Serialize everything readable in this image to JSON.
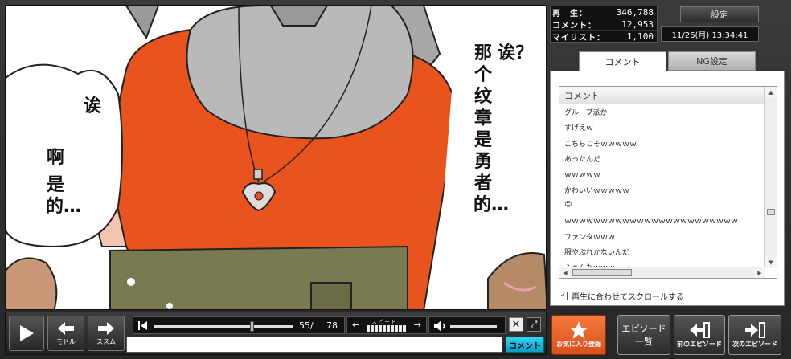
{
  "video": {
    "bubble_left_1": "诶",
    "bubble_left_2": "啊",
    "bubble_left_3": "是的…",
    "bubble_right_1": "诶？",
    "bubble_right_2": "那个纹章是勇者的…"
  },
  "stats": {
    "views_label": "再　生：",
    "views": "346,788",
    "comments_label": "コメント：",
    "comments": "12,953",
    "mylist_label": "マイリスト：",
    "mylist": "1,100"
  },
  "settings_label": "設定",
  "datetime": "11/26(月) 13:34:41",
  "tabs": {
    "comment": "コメント",
    "ng": "NG設定"
  },
  "comment_list": {
    "header": "コメント",
    "items": [
      "グループ派か",
      "すげえｗ",
      "こちらこそｗｗｗｗｗ",
      "あったんだ",
      "ｗｗｗｗｗ",
      "かわいいｗｗｗｗｗ",
      "☺",
      "ｗｗｗｗｗｗｗｗｗｗｗｗｗｗｗｗｗｗｗｗｗｗｗｗ",
      "ファンタｗｗｗ",
      "服やぶれかないんだ",
      "ふぁんたｗｗｗ"
    ]
  },
  "autoscroll_label": "再生に合わせてスクロールする",
  "player": {
    "back_label": "モドル",
    "forward_label": "ススム",
    "current": "55/",
    "total": "78",
    "progress_fraction": 0.705,
    "speed_label": "スピード",
    "submit_label": "コメント"
  },
  "buttons": {
    "favorite": "お気に入り登録",
    "episode_list_1": "エピソード",
    "episode_list_2": "一覧",
    "prev_episode": "前のエピソード",
    "next_episode": "次のエピソード"
  },
  "colors": {
    "accent_cyan": "#1bbbe0",
    "favorite_orange": "#e8602a",
    "shirt_orange": "#e8531e"
  }
}
